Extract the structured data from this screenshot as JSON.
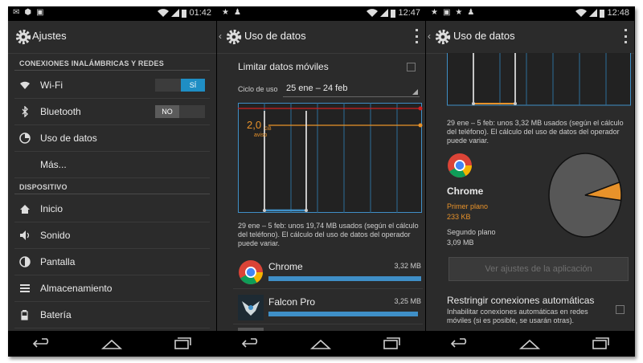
{
  "screen1": {
    "status_time": "01:42",
    "title": "Ajustes",
    "section_wireless": "CONEXIONES INALÁMBRICAS Y REDES",
    "wifi_label": "Wi-Fi",
    "wifi_toggle": "SÍ",
    "bluetooth_label": "Bluetooth",
    "bluetooth_toggle": "NO",
    "data_usage_label": "Uso de datos",
    "more_label": "Más...",
    "section_device": "DISPOSITIVO",
    "home_label": "Inicio",
    "sound_label": "Sonido",
    "display_label": "Pantalla",
    "storage_label": "Almacenamiento",
    "battery_label": "Batería"
  },
  "screen2": {
    "status_time": "12:47",
    "title": "Uso de datos",
    "limit_mobile_data": "Limitar datos móviles",
    "cycle_label": "Ciclo de uso",
    "cycle_value": "25 ene – 24 feb",
    "warning_value": "2,0",
    "warning_unit": "GB",
    "warning_label": "aviso",
    "usage_note": "29 ene – 5 feb: unos 19,74 MB usados (según el cálculo del teléfono). El cálculo del uso de datos del operador puede variar.",
    "apps": [
      {
        "name": "Chrome",
        "size": "3,32 MB",
        "usage_fraction": 1.0
      },
      {
        "name": "Falcon Pro",
        "size": "3,25 MB",
        "usage_fraction": 0.98
      }
    ]
  },
  "screen3": {
    "status_time": "12:48",
    "title": "Uso de datos",
    "usage_note": "29 ene – 5 feb: unos 3,32 MB usados (según el cálculo del teléfono). El cálculo del uso de datos del operador puede variar.",
    "app_name": "Chrome",
    "foreground_label": "Primer plano",
    "foreground_value": "233 KB",
    "background_label": "Segundo plano",
    "background_value": "3,09 MB",
    "app_settings_button": "Ver ajustes de la aplicación",
    "restrict_title": "Restringir conexiones automáticas",
    "restrict_desc": "Inhabilitar conexiones automáticas en redes móviles (si es posible, se usarán otras).",
    "pie_foreground_fraction": 0.07
  },
  "colors": {
    "accent_blue": "#1f8ec4",
    "warning_orange": "#e8922a",
    "limit_red": "#d02020",
    "background": "#2b2b2b"
  }
}
